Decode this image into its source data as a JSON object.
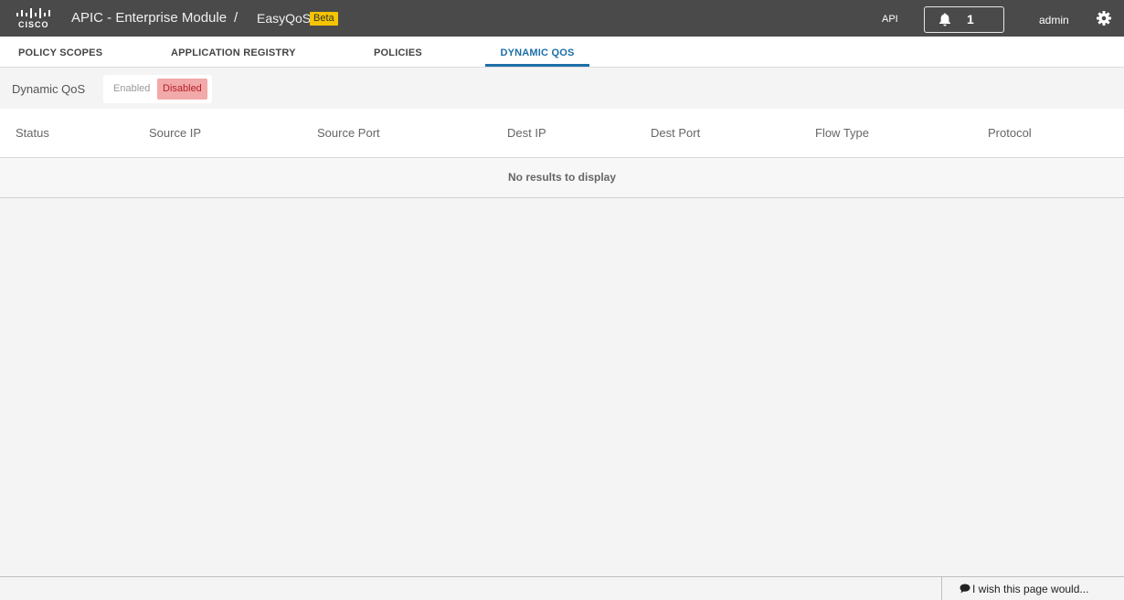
{
  "header": {
    "logo_text": "CISCO",
    "app_title": "APIC - Enterprise Module",
    "separator": "/",
    "module": "EasyQoS",
    "badge": "Beta",
    "api_label": "API",
    "notification_count": "1",
    "user": "admin"
  },
  "tabs": [
    {
      "label": "POLICY SCOPES",
      "active": false
    },
    {
      "label": "APPLICATION REGISTRY",
      "active": false
    },
    {
      "label": "POLICIES",
      "active": false
    },
    {
      "label": "DYNAMIC QOS",
      "active": true
    }
  ],
  "dynamic_qos": {
    "label": "Dynamic QoS",
    "options": {
      "enabled": "Enabled",
      "disabled": "Disabled"
    },
    "selected": "Disabled"
  },
  "table": {
    "columns": [
      "Status",
      "Source IP",
      "Source Port",
      "Dest IP",
      "Dest Port",
      "Flow Type",
      "Protocol"
    ],
    "rows": [],
    "empty_message": "No results to display"
  },
  "footer": {
    "feedback_label": "I wish this page would..."
  },
  "colors": {
    "topbar": "#4a4a4a",
    "accent": "#1d6fa8",
    "badge": "#f5c400",
    "disabled_bg": "#f2a9a9",
    "disabled_text": "#b3202a"
  }
}
